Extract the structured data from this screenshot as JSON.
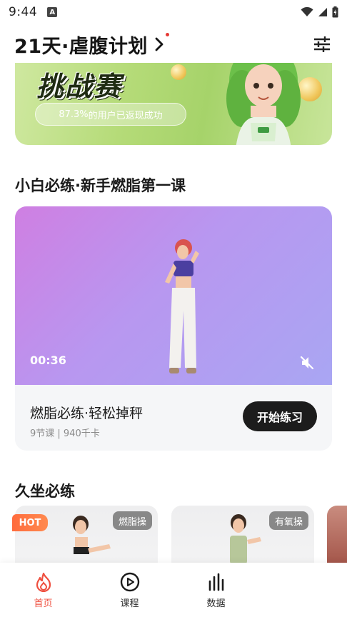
{
  "status_bar": {
    "time": "9:44",
    "a_badge": "A"
  },
  "header": {
    "plan_title": "21天·虐腹计划",
    "chevron_icon": "chevron-right-icon",
    "filter_icon": "sliders-icon"
  },
  "banner": {
    "title": "挑战赛",
    "pill_percent": "87.3%",
    "pill_text": "的用户已返现成功"
  },
  "section1": {
    "title": "小白必练·新手燃脂第一课"
  },
  "video_card": {
    "duration": "00:36",
    "course_name": "燃脂必练·轻松掉秤",
    "meta": "9节课 | 940千卡",
    "start_label": "开始练习"
  },
  "section2": {
    "title": "久坐必练"
  },
  "mini_cards": [
    {
      "tag": "燃脂操",
      "badge": "HOT"
    },
    {
      "tag": "有氧操"
    }
  ],
  "nav": {
    "items": [
      {
        "label": "首页",
        "icon": "flame-icon",
        "active": true
      },
      {
        "label": "课程",
        "icon": "play-circle-icon",
        "active": false
      },
      {
        "label": "数据",
        "icon": "bar-chart-icon",
        "active": false
      }
    ]
  },
  "colors": {
    "accent": "#ef4f3f",
    "button_dark": "#1c1c1c",
    "banner_green": "#a6d36a"
  }
}
